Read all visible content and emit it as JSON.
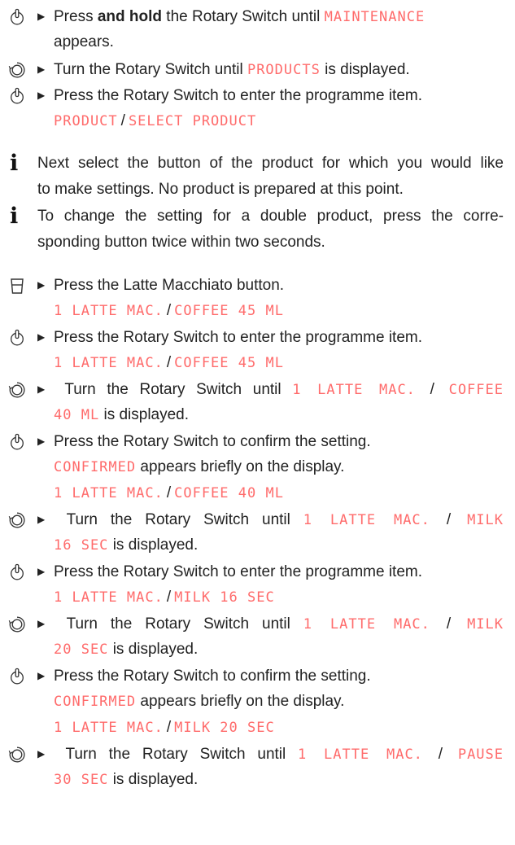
{
  "s1": {
    "a": "Press ",
    "b": "and hold",
    "c": " the Rotary Switch until ",
    "d": "MAINTENANCE",
    "e": "appears."
  },
  "s2": {
    "a": "Turn the Rotary Switch until ",
    "b": "PRODUCTS",
    "c": " is displayed."
  },
  "s3": {
    "a": "Press the Rotary Switch to enter the programme item.",
    "b": "PRODUCT",
    "sep": "/",
    "c": "SELECT PRODUCT"
  },
  "i1": {
    "l1": "Next select the button of the product for which you would like",
    "l2": "to make settings. No product is prepared at this point."
  },
  "i2": {
    "l1": "To change the setting for a double product, press the corre-",
    "l2": "sponding button twice within two seconds."
  },
  "s4": {
    "a": "Press the Latte Macchiato button.",
    "b": "1 LATTE MAC.",
    "sep": "/",
    "c": "COFFEE 45 ML"
  },
  "s5": {
    "a": "Press the Rotary Switch to enter the programme item.",
    "b": "1 LATTE MAC.",
    "sep": "/",
    "c": "COFFEE 45 ML"
  },
  "s6": {
    "a": "Turn the Rotary Switch until ",
    "b": "1 LATTE MAC.",
    "sep": "/",
    "c": "COFFEE",
    "d": "40 ML",
    "e": " is displayed."
  },
  "s7": {
    "a": "Press the Rotary Switch to confirm the setting.",
    "b": "CONFIRMED",
    "c": " appears briefly on the display.",
    "d": "1 LATTE MAC.",
    "sep": "/",
    "e": "COFFEE 40 ML"
  },
  "s8": {
    "a": "Turn the Rotary Switch until ",
    "b": "1 LATTE MAC.",
    "sep": "/",
    "c": "MILK",
    "d": "16 SEC",
    "e": " is displayed."
  },
  "s9": {
    "a": "Press the Rotary Switch to enter the programme item.",
    "b": "1 LATTE MAC.",
    "sep": "/",
    "c": "MILK 16 SEC"
  },
  "s10": {
    "a": "Turn the Rotary Switch until ",
    "b": "1 LATTE MAC.",
    "sep": "/",
    "c": "MILK",
    "d": "20 SEC",
    "e": " is displayed."
  },
  "s11": {
    "a": "Press the Rotary Switch to confirm the setting.",
    "b": "CONFIRMED",
    "c": " appears briefly on the display.",
    "d": "1 LATTE MAC.",
    "sep": "/",
    "e": "MILK 20 SEC"
  },
  "s12": {
    "a": "Turn the Rotary Switch until ",
    "b": "1 LATTE MAC.",
    "sep": "/",
    "c": "PAUSE",
    "d": "30 SEC",
    "e": " is displayed."
  },
  "icons": {
    "press": "press-switch-icon",
    "turn": "rotate-switch-icon",
    "info": "info-icon",
    "cup": "latte-macchiato-button-icon",
    "bullet": "triangle-bullet-icon"
  },
  "colors": {
    "display_text": "#ff6b6b",
    "body_text": "#222222"
  }
}
